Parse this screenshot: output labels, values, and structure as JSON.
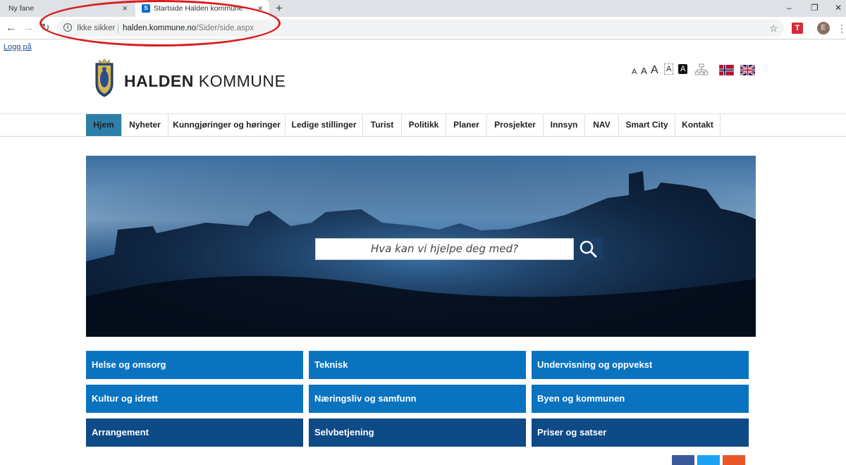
{
  "browser": {
    "tabs": [
      {
        "title": "Ny fane"
      },
      {
        "title": "Startside Halden kommune"
      }
    ],
    "new_tab": "+",
    "close_glyph": "×",
    "window_controls": [
      "–",
      "❐",
      "✕"
    ],
    "address": {
      "security_label": "Ikke sikker",
      "host": "halden.kommune.no",
      "path": "/Sider/side.aspx"
    },
    "extension_label": "T",
    "profile_initial": "E",
    "annotation_color": "#d91c1c"
  },
  "page": {
    "login_link": "Logg på",
    "logo": {
      "bold": "HALDEN",
      "light": " KOMMUNE"
    },
    "text_size_controls": [
      "A",
      "A",
      "A"
    ],
    "contrast_controls": [
      "A",
      "A"
    ],
    "nav": [
      "Hjem",
      "Nyheter",
      "Kunngjøringer og høringer",
      "Ledige stillinger",
      "Turist",
      "Politikk",
      "Planer",
      "Prosjekter",
      "Innsyn",
      "NAV",
      "Smart City",
      "Kontakt"
    ],
    "active_nav": "Hjem",
    "search_placeholder": "Hva kan vi hjelpe deg med?",
    "tiles": [
      [
        "Helse og omsorg",
        "Teknisk",
        "Undervisning og oppvekst"
      ],
      [
        "Kultur og idrett",
        "Næringsliv og samfunn",
        "Byen og kommunen"
      ],
      [
        "Arrangement",
        "Selvbetjening",
        "Priser og satser"
      ]
    ],
    "colors": {
      "tile_light": "#0a73c0",
      "tile_dark": "#0d4a86",
      "nav_active": "#2d7ea9",
      "search_button": "#1a3d64"
    }
  }
}
